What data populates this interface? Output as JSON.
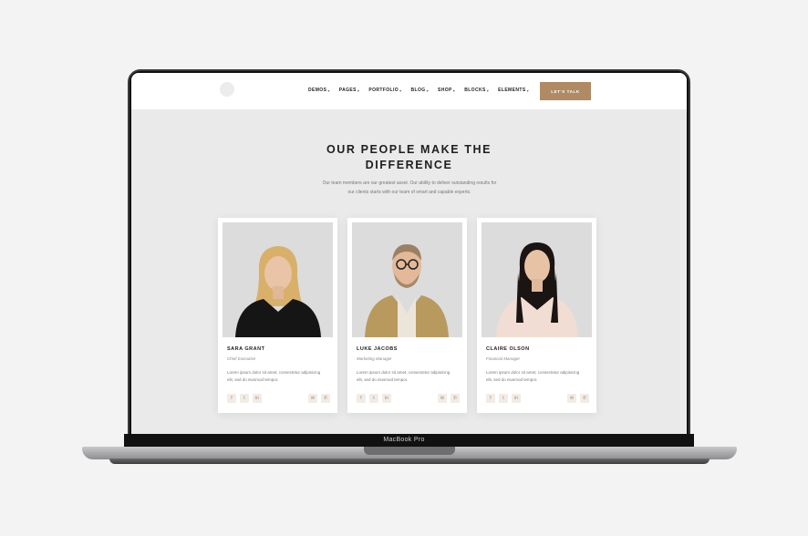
{
  "nav": {
    "items": [
      {
        "label": "DEMOS"
      },
      {
        "label": "PAGES"
      },
      {
        "label": "PORTFOLIO"
      },
      {
        "label": "BLOG"
      },
      {
        "label": "SHOP"
      },
      {
        "label": "BLOCKS"
      },
      {
        "label": "ELEMENTS"
      }
    ],
    "cta_label": "LET'S TALK"
  },
  "hero": {
    "title_line1": "OUR PEOPLE MAKE THE",
    "title_line2": "DIFFERENCE",
    "desc_line1": "Our team members are our greatest asset. Our ability to deliver outstanding results for",
    "desc_line2": "our clients starts with our team of smart and capable experts."
  },
  "team": [
    {
      "name": "SARA GRANT",
      "role": "Chief Executive",
      "bio_line1": "Lorem ipsum dolor sit amet, consectetur adipisicing",
      "bio_line2": "elit, sed do eiusmod tempor."
    },
    {
      "name": "LUKE JACOBS",
      "role": "Marketing Manager",
      "bio_line1": "Lorem ipsum dolor sit amet, consectetur adipisicing",
      "bio_line2": "elit, sed do eiusmod tempor."
    },
    {
      "name": "CLAIRE OLSON",
      "role": "Financial Manager",
      "bio_line1": "Lorem ipsum dolor sit amet, consectetur adipisicing",
      "bio_line2": "elit, sed do eiusmod tempor."
    }
  ],
  "socials": {
    "facebook": "f",
    "twitter": "t",
    "linkedin": "in"
  },
  "device_label": "MacBook Pro",
  "colors": {
    "accent": "#b08a63",
    "page_bg": "#eaeaea",
    "card_bg": "#ffffff"
  }
}
